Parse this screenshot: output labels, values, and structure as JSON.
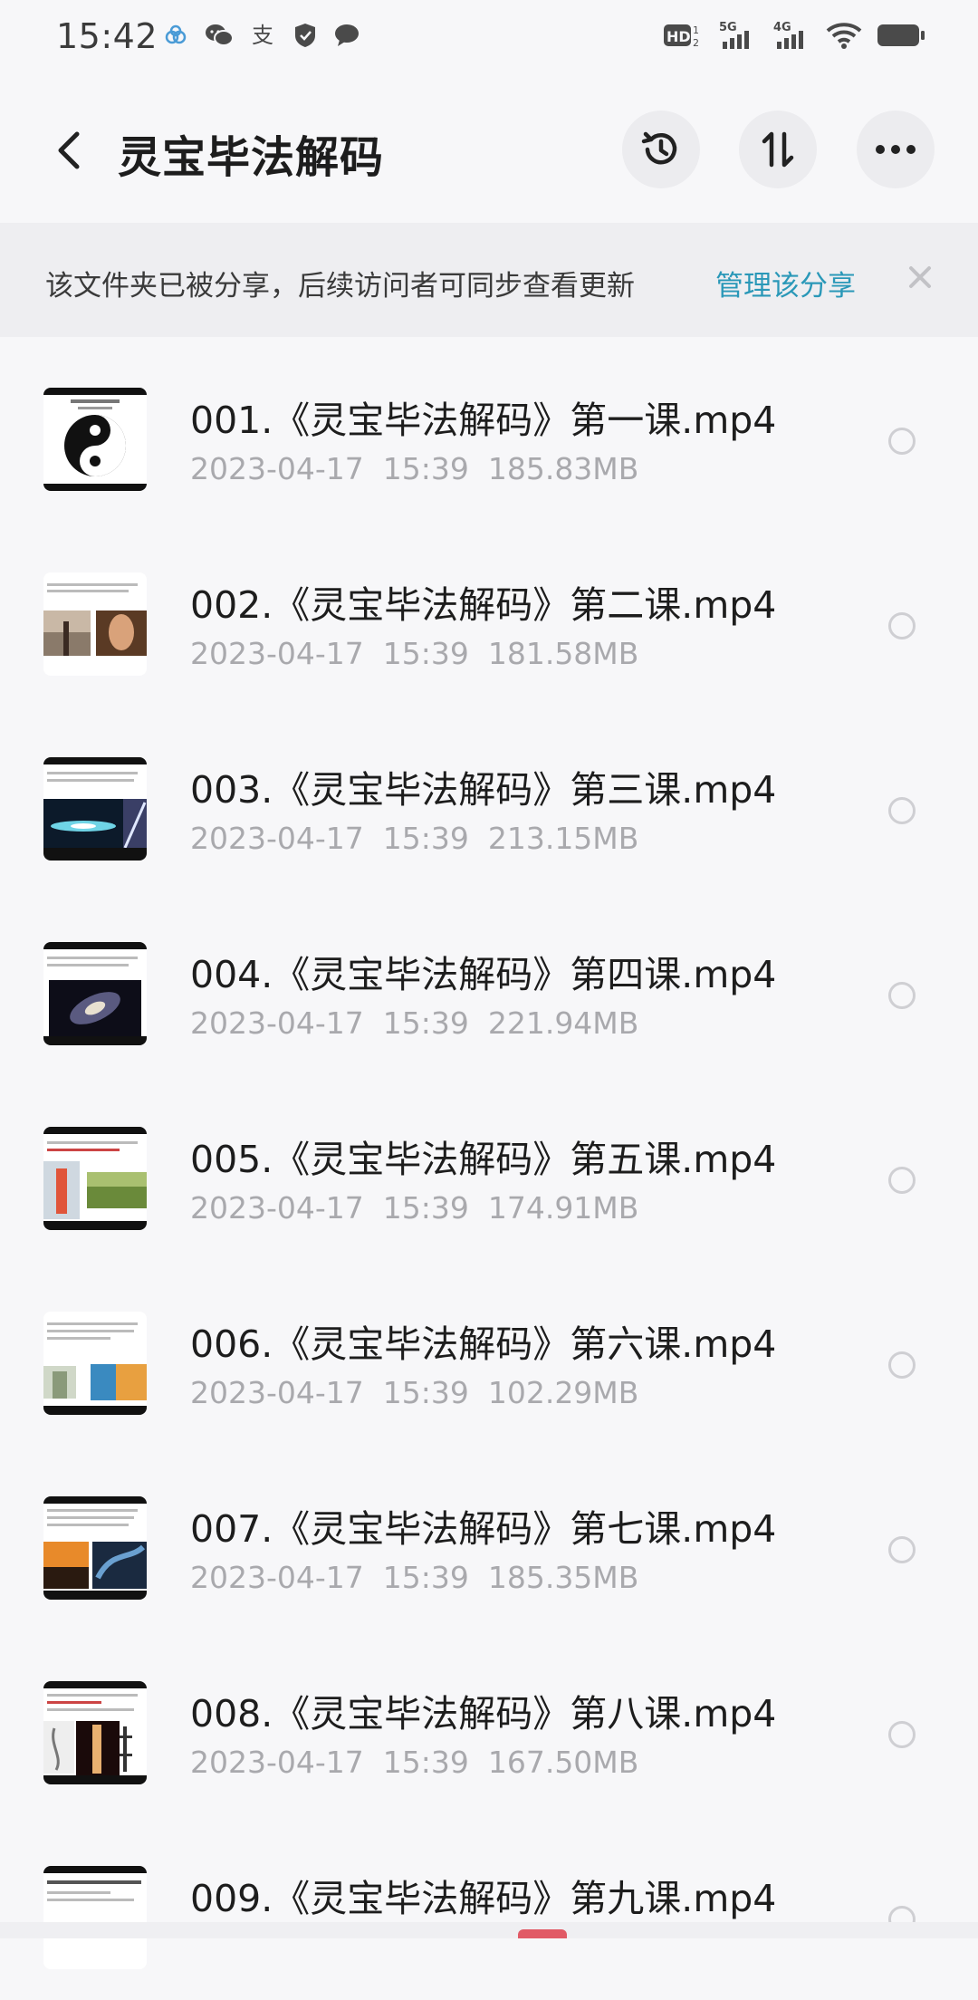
{
  "status_bar": {
    "time": "15:42",
    "left_icons": [
      "cloud-icon",
      "wechat-icon",
      "alipay-icon",
      "shield-icon",
      "chat-bubble-icon"
    ],
    "right_icons": [
      "hd-icon",
      "signal-5g-icon",
      "signal-4g-icon",
      "wifi-icon",
      "battery-icon"
    ],
    "hd_label": "HD",
    "network_5g": "5G",
    "network_4g": "4G"
  },
  "header": {
    "title": "灵宝毕法解码",
    "buttons": [
      "history-icon",
      "sort-icon",
      "more-icon"
    ]
  },
  "share_banner": {
    "message": "该文件夹已被分享，后续访问者可同步查看更新",
    "action_label": "管理该分享",
    "close_icon": "close-icon"
  },
  "files": [
    {
      "name": "001.《灵宝毕法解码》第一课.mp4",
      "meta": "2023-04-17  15:39  185.83MB",
      "thumb": "yin-yang"
    },
    {
      "name": "002.《灵宝毕法解码》第二课.mp4",
      "meta": "2023-04-17  15:39  181.58MB",
      "thumb": "two-photos-warm"
    },
    {
      "name": "003.《灵宝毕法解码》第三课.mp4",
      "meta": "2023-04-17  15:39  213.15MB",
      "thumb": "space-nebula"
    },
    {
      "name": "004.《灵宝毕法解码》第四课.mp4",
      "meta": "2023-04-17  15:39  221.94MB",
      "thumb": "galaxy"
    },
    {
      "name": "005.《灵宝毕法解码》第五课.mp4",
      "meta": "2023-04-17  15:39  174.91MB",
      "thumb": "two-photos-green"
    },
    {
      "name": "006.《灵宝毕法解码》第六课.mp4",
      "meta": "2023-04-17  15:39  102.29MB",
      "thumb": "two-photos-orange"
    },
    {
      "name": "007.《灵宝毕法解码》第七课.mp4",
      "meta": "2023-04-17  15:39  185.35MB",
      "thumb": "two-photos-sunset"
    },
    {
      "name": "008.《灵宝毕法解码》第八课.mp4",
      "meta": "2023-04-17  15:39  167.50MB",
      "thumb": "spine-diagram"
    },
    {
      "name": "009.《灵宝毕法解码》第九课.mp4",
      "meta": "",
      "thumb": "text-slide"
    }
  ],
  "colors": {
    "accent": "#2a98b8",
    "background": "#f7f7f9",
    "banner_bg": "#eeeef1",
    "meta_text": "#a9a9ad"
  }
}
